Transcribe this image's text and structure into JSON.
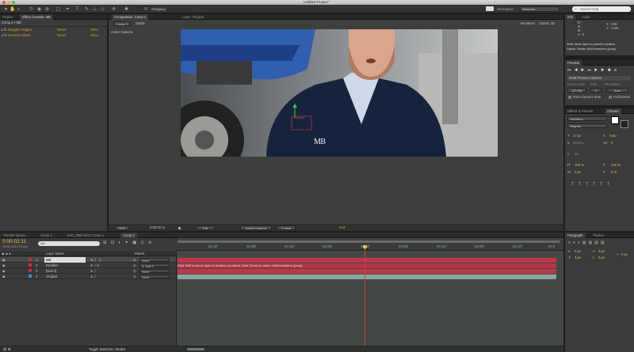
{
  "window": {
    "title": "Untitled Project *"
  },
  "toolbar": {
    "tools": [
      "selection-tool",
      "hand-tool",
      "zoom-tool",
      "rotation-tool",
      "camera-tool",
      "pan-behind-tool",
      "mask-tool",
      "pen-tool",
      "text-tool",
      "brush-tool",
      "clone-tool",
      "eraser-tool",
      "roto-tool",
      "puppet-tool"
    ],
    "snapping_label": "Snapping",
    "workspace_label": "Workspace:",
    "workspace_value": "Standard",
    "search_placeholder": "Search Help"
  },
  "project_panel": {
    "tabs": [
      "Project",
      "Effect Controls: MB"
    ],
    "comp_label": "Comp 2 • MB",
    "effects": [
      {
        "name": "Roughen Edges",
        "reset": "Reset",
        "about": "Abou"
      },
      {
        "name": "Venetian Blinds",
        "reset": "Reset",
        "about": "Abou"
      }
    ]
  },
  "composition_panel": {
    "tabs": [
      "Composition: Comp 2",
      "Layer: Original"
    ],
    "subtabs": [
      "Comp 2",
      "Stable"
    ],
    "renderer_label": "Renderer:",
    "renderer_value": "Classic 3D",
    "camera_label": "Active Camera",
    "overlay_text": "MB",
    "footer": {
      "zoom": "50%",
      "timecode": "0:00:02:11",
      "resolution": "Full",
      "camera": "Active Camera",
      "view": "1 View",
      "exposure": "+0.0"
    }
  },
  "info_panel": {
    "tabs": [
      "Info",
      "Audio"
    ],
    "r": "R :",
    "g": "G :",
    "b": "B :",
    "a": "A : 0",
    "x": "X : 238",
    "y": "Y : 1430",
    "message": "Shift: Move layer to parent's location.",
    "message2": "Option: Retain child transform (jump)."
  },
  "preview_panel": {
    "tab": "Preview",
    "ram_options": "RAM Preview Options",
    "frame_rate_label": "Frame Rate",
    "skip_label": "Skip",
    "resolution_label": "Resolution",
    "frame_rate_value": "(23.98)",
    "skip_value": "0",
    "resolution_value": "Auto",
    "from_current": "From Current Time",
    "full_screen": "Full Screen"
  },
  "character_panel": {
    "tabs": [
      "Effects & Presets",
      "Charact"
    ],
    "font": "Helvetica",
    "style": "Regular",
    "size": "17 px",
    "leading": "Auto",
    "kerning": "Metrics",
    "tracking": "0",
    "stroke": "- px",
    "vscale": "100 %",
    "hscale": "100 %",
    "baseline": "0 px",
    "tsume": "0 %"
  },
  "paragraph_panel": {
    "tabs": [
      "Paragraph",
      "Tracker"
    ],
    "indent_left": "0 px",
    "indent_right": "0 px",
    "space_before": "0 px",
    "space_after": "0 px",
    "first_line": "0 px"
  },
  "timeline": {
    "tabs": [
      "Render Queue",
      "Comp 1",
      "IMG_0564.MOV Comp 1",
      "Comp 2"
    ],
    "timecode": "0:00:02:11",
    "fps": "00059 (23.976 fps)",
    "search_placeholder": "Q▾",
    "col_layer_name": "Layer Name",
    "col_parent": "Parent",
    "ruler": [
      "00:12f",
      "01:00f",
      "01:12f",
      "02:00f",
      "02:12f",
      "03:00f",
      "03:12f",
      "04:00f",
      "04:12f",
      "05:0"
    ],
    "layers": [
      {
        "num": "1",
        "name": "MB",
        "color": "#c03040",
        "parent": "None"
      },
      {
        "num": "2",
        "name": "Doobles",
        "color": "#c03040",
        "parent": "3. Null 2"
      },
      {
        "num": "3",
        "name": "[Null 2]",
        "color": "#c03040",
        "parent": "None"
      },
      {
        "num": "4",
        "name": "Original",
        "color": "#3a8ac8",
        "parent": "None"
      }
    ],
    "tooltip": "Hold Shift to move layer to location of parent. Hold Option to retain child transform (jump).",
    "toggle_label": "Toggle Switches / Modes"
  },
  "colors": {
    "accent": "#e6c43c",
    "layer_red": "#c03848",
    "layer_teal": "#8aa4a0",
    "playhead": "#d04040"
  }
}
